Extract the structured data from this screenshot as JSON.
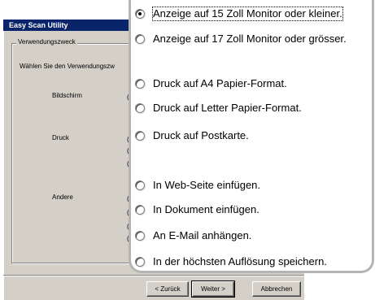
{
  "window": {
    "title": "Easy Scan Utility"
  },
  "group": {
    "legend": "Verwendungszweck",
    "prompt": "Wählen Sie den Verwendungszw",
    "categories": [
      "Bildschirm",
      "Druck",
      "Andere"
    ],
    "tick_glyph": "("
  },
  "buttons": {
    "back": "< Zurück",
    "next": "Weiter >",
    "cancel": "Abbrechen"
  },
  "options": [
    {
      "label": "Anzeige auf 15 Zoll Monitor oder kleiner.",
      "selected": true
    },
    {
      "label": "Anzeige auf 17 Zoll Monitor oder grösser.",
      "selected": false
    },
    {
      "label": "Druck auf A4 Papier-Format.",
      "selected": false
    },
    {
      "label": "Druck auf Letter Papier-Format.",
      "selected": false
    },
    {
      "label": "Druck auf Postkarte.",
      "selected": false
    },
    {
      "label": "In Web-Seite einfügen.",
      "selected": false
    },
    {
      "label": "In Dokument einfügen.",
      "selected": false
    },
    {
      "label": "An E-Mail anhängen.",
      "selected": false
    },
    {
      "label": "In der höchsten Auflösung speichern.",
      "selected": false
    }
  ]
}
